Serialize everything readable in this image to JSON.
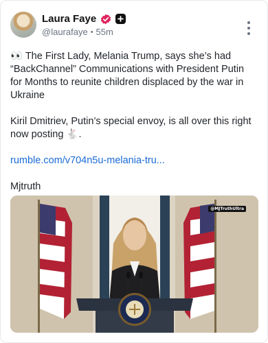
{
  "author": {
    "name": "Laura Faye",
    "handle": "@laurafaye",
    "time": "55m"
  },
  "post": {
    "para1": "👀 The First Lady, Melania Trump, says she’s had “BackChannel” Communications with President Putin for Months to reunite children displaced by the war in Ukraine",
    "para2": "Kiril Dmitriev, Putin’s special envoy, is all over this right now posting 🐇.",
    "link": "rumble.com/v704n5u-melania-tru...",
    "sign": "Mjtruth"
  },
  "media": {
    "watermark": "@MJTruthUltra"
  },
  "colors": {
    "verified": "#e0245e",
    "link": "#1a6bd6"
  }
}
